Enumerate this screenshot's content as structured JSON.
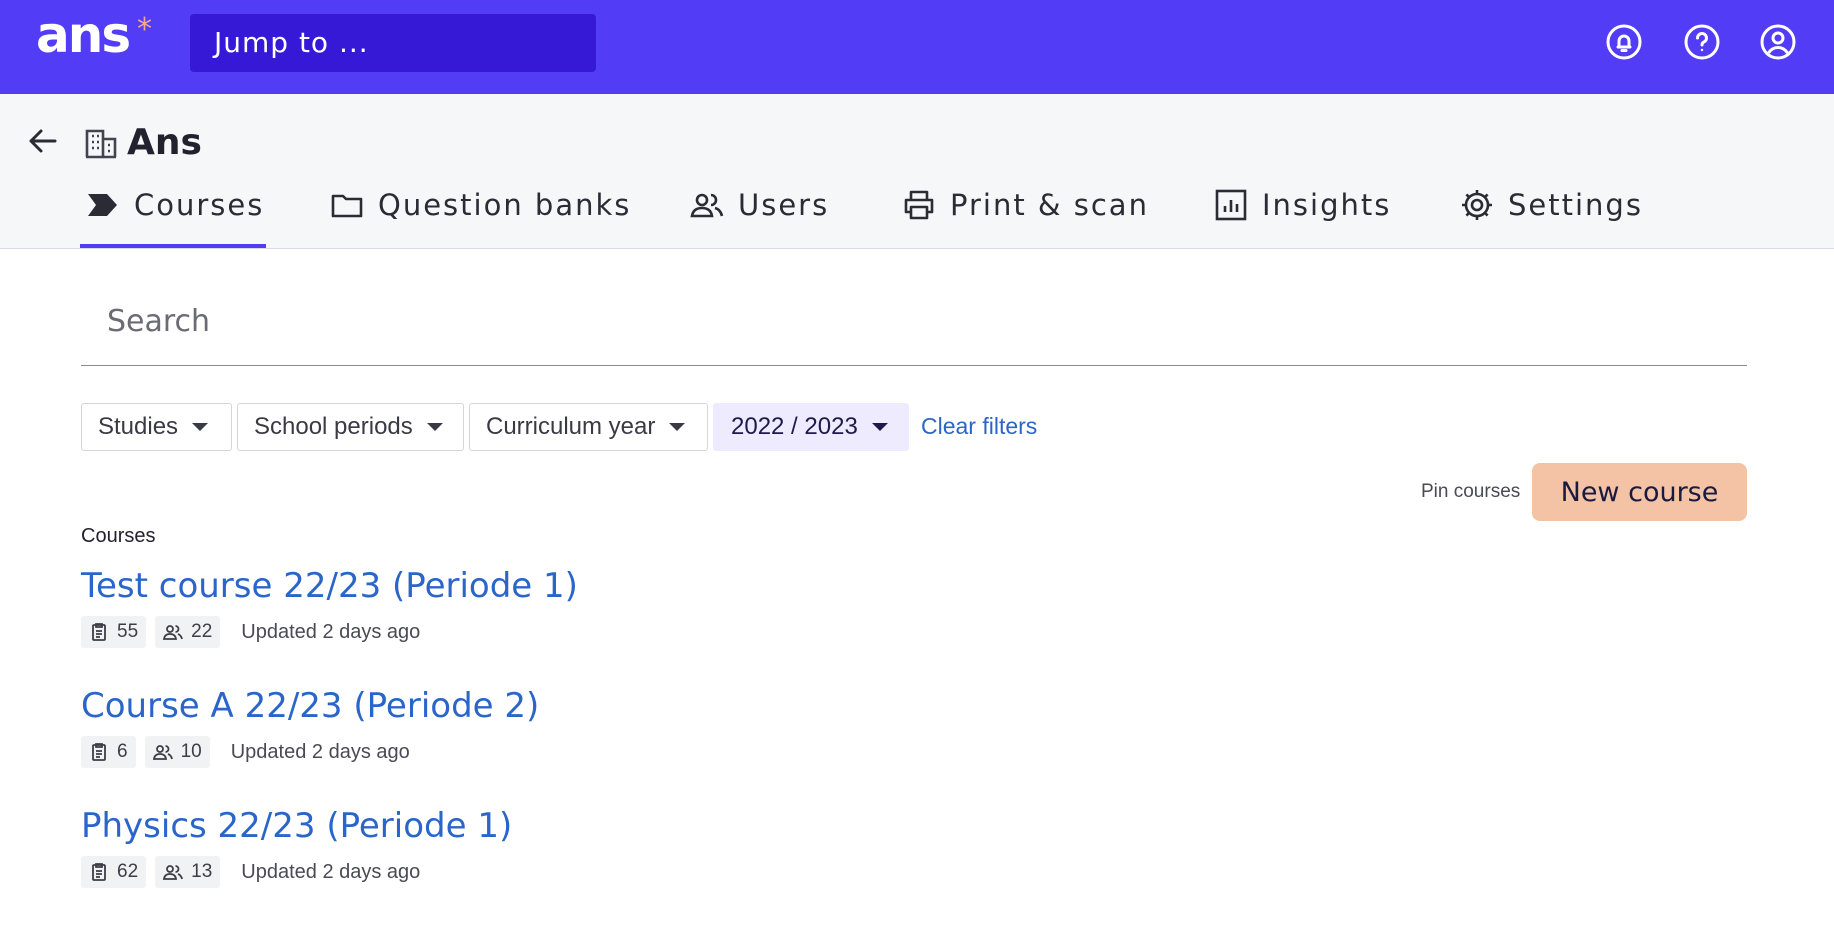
{
  "app": {
    "logo": "ans",
    "logo_star": "*",
    "jump_placeholder": "Jump to ..."
  },
  "topbar_icons": [
    "bell-icon",
    "help-icon",
    "account-icon"
  ],
  "org": {
    "name": "Ans"
  },
  "tabs": [
    {
      "label": "Courses",
      "icon": "courses-tag-icon",
      "active": true
    },
    {
      "label": "Question banks",
      "icon": "folder-icon",
      "active": false
    },
    {
      "label": "Users",
      "icon": "users-icon",
      "active": false
    },
    {
      "label": "Print & scan",
      "icon": "printer-icon",
      "active": false
    },
    {
      "label": "Insights",
      "icon": "bar-chart-icon",
      "active": false
    },
    {
      "label": "Settings",
      "icon": "gear-icon",
      "active": false
    }
  ],
  "search": {
    "placeholder": "Search"
  },
  "filters": [
    {
      "label": "Studies",
      "selected": false
    },
    {
      "label": "School periods",
      "selected": false
    },
    {
      "label": "Curriculum year",
      "selected": false
    },
    {
      "label": "2022 / 2023",
      "selected": true
    }
  ],
  "clear_filters": "Clear filters",
  "actions": {
    "pin": "Pin courses",
    "new_course": "New course"
  },
  "colors": {
    "brand": "#533cf5",
    "link": "#2a66c9",
    "cta": "#f4c2a4"
  },
  "courses": {
    "label": "Courses",
    "items": [
      {
        "title": "Test course 22/23 (Periode 1)",
        "assignments": "55",
        "users": "22",
        "updated": "Updated 2 days ago"
      },
      {
        "title": "Course A 22/23 (Periode 2)",
        "assignments": "6",
        "users": "10",
        "updated": "Updated 2 days ago"
      },
      {
        "title": "Physics 22/23 (Periode 1)",
        "assignments": "62",
        "users": "13",
        "updated": "Updated 2 days ago"
      }
    ]
  }
}
